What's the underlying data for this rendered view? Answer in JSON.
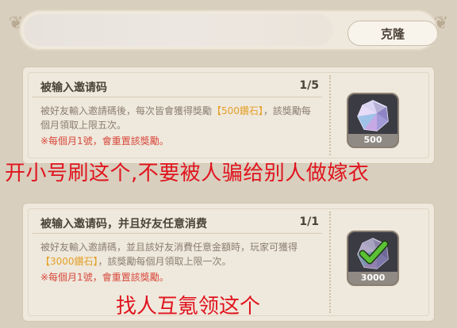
{
  "top_bar": {
    "clone_label": "克隆"
  },
  "tasks": [
    {
      "title": "被输入邀请码",
      "progress": "1/5",
      "desc_before": "被好友輸入邀請碼後，每次皆會獲得獎勵",
      "desc_highlight": "【500鑽石】",
      "desc_after": "，該獎勵每個月領取上限五次。",
      "note": "※每個月1號，會重置該獎勵。",
      "reward_amount": "500",
      "claimed": false
    },
    {
      "title": "被输入邀请码，并且好友任意消费",
      "progress": "1/1",
      "desc_before": "被好友輸入邀請碼，並且該好友消費任意金額時，玩家可獲得",
      "desc_highlight": "【3000鑽石】",
      "desc_after": "，該獎勵每個月領取上限一次。",
      "note": "※每個月1號，會重置該獎勵。",
      "reward_amount": "3000",
      "claimed": true
    }
  ],
  "overlays": {
    "caption_1": "开小号刷这个,不要被人骗给别人做嫁衣",
    "caption_2": "找人互氪领这个"
  },
  "colors": {
    "highlight": "#e3a028",
    "note_red": "#d8483c",
    "caption_red": "#e0141e",
    "check_green": "#5bc236"
  },
  "icons": {
    "reward": "diamond-gem-icon",
    "claimed": "checkmark-icon"
  }
}
